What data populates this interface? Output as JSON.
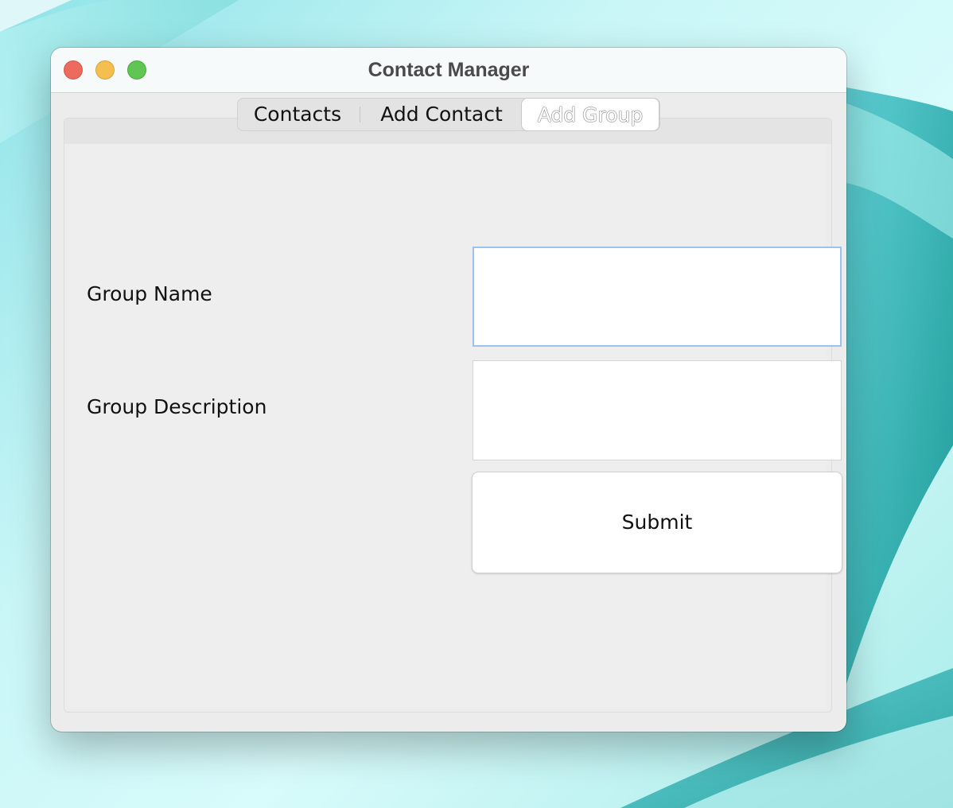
{
  "window": {
    "title": "Contact Manager"
  },
  "tabs": [
    {
      "label": "Contacts",
      "selected": false
    },
    {
      "label": "Add Contact",
      "selected": false
    },
    {
      "label": "Add Group",
      "selected": true
    }
  ],
  "form": {
    "group_name_label": "Group Name",
    "group_name_value": "",
    "group_description_label": "Group Description",
    "group_description_value": "",
    "submit_label": "Submit"
  },
  "colors": {
    "close": "#ed6a5e",
    "minimize": "#f5bf4f",
    "maximize": "#61c554",
    "focus_ring": "#9cc3ee"
  },
  "icons": [
    "close-traffic-light-icon",
    "minimize-traffic-light-icon",
    "maximize-traffic-light-icon"
  ]
}
